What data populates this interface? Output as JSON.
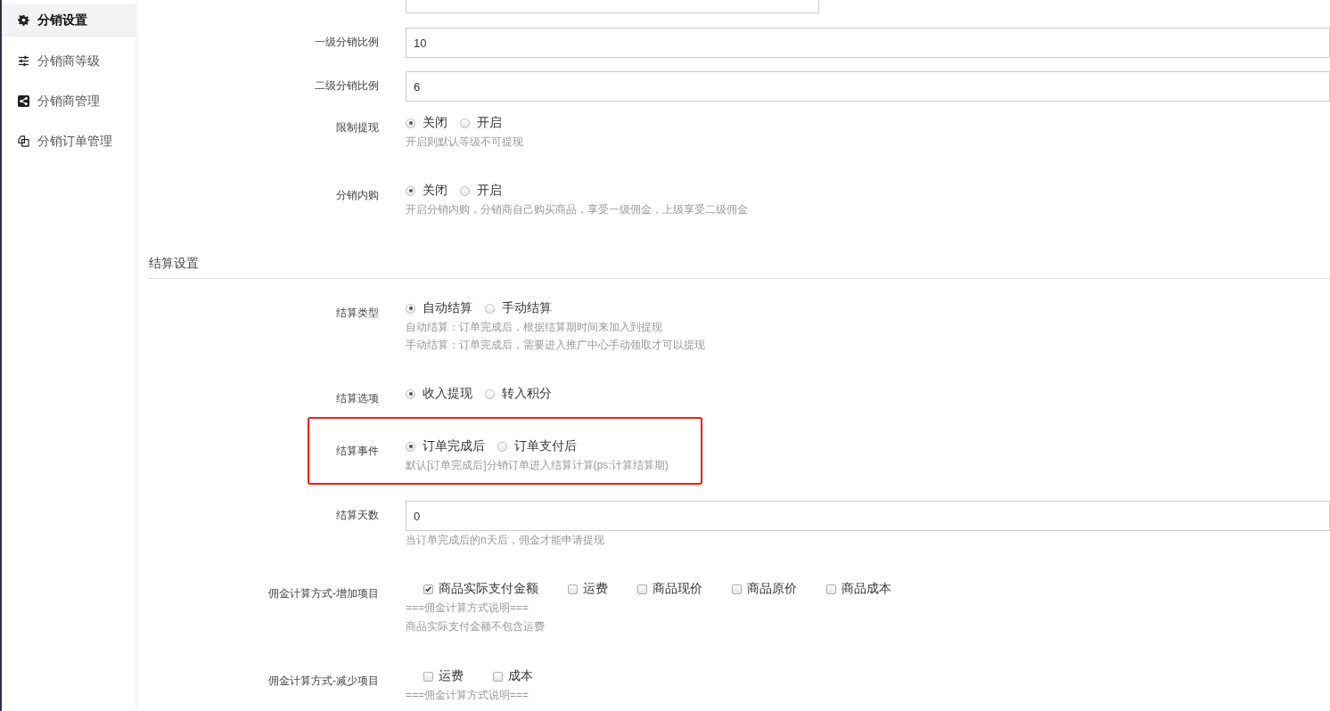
{
  "sidebar": {
    "items": [
      {
        "label": "分销设置",
        "selected": true
      },
      {
        "label": "分销商等级",
        "selected": false
      },
      {
        "label": "分销商管理",
        "selected": false
      },
      {
        "label": "分销订单管理",
        "selected": false
      }
    ]
  },
  "form": {
    "rows": [
      {
        "kind": "select"
      },
      {
        "kind": "input",
        "label": "一级分销比例",
        "value": "10"
      },
      {
        "kind": "input",
        "label": "二级分销比例",
        "value": "6"
      },
      {
        "kind": "radio",
        "label": "限制提现",
        "options": [
          {
            "label": "关闭",
            "selected": true
          },
          {
            "label": "开启",
            "selected": false
          }
        ],
        "help": [
          "开启则默认等级不可提现"
        ]
      },
      {
        "kind": "radio",
        "label": "分销内购",
        "options": [
          {
            "label": "关闭",
            "selected": true
          },
          {
            "label": "开启",
            "selected": false
          }
        ],
        "help": [
          "开启分销内购，分销商自己购买商品，享受一级佣金，上级享受二级佣金"
        ]
      },
      {
        "kind": "section",
        "title": "结算设置"
      },
      {
        "kind": "radio",
        "label": "结算类型",
        "options": [
          {
            "label": "自动结算",
            "selected": true
          },
          {
            "label": "手动结算",
            "selected": false
          }
        ],
        "help": [
          "自动结算：订单完成后，根据结算期时间来加入到提现",
          "手动结算：订单完成后，需要进入推广中心手动领取才可以提现"
        ]
      },
      {
        "kind": "radio",
        "label": "结算选项",
        "options": [
          {
            "label": "收入提现",
            "selected": true
          },
          {
            "label": "转入积分",
            "selected": false
          }
        ]
      },
      {
        "kind": "radio",
        "label": "结算事件",
        "highlighted": true,
        "options": [
          {
            "label": "订单完成后",
            "selected": true
          },
          {
            "label": "订单支付后",
            "selected": false
          }
        ],
        "help": [
          "默认[订单完成后]分销订单进入结算计算(ps:计算结算期)"
        ]
      },
      {
        "kind": "input",
        "label": "结算天数",
        "value": "0",
        "help": [
          "当订单完成后的n天后，佣金才能申请提现"
        ]
      },
      {
        "kind": "checkbox",
        "label": "佣金计算方式-增加项目",
        "options": [
          {
            "label": "商品实际支付金额",
            "checked": true
          },
          {
            "label": "运费",
            "checked": false
          },
          {
            "label": "商品现价",
            "checked": false
          },
          {
            "label": "商品原价",
            "checked": false
          },
          {
            "label": "商品成本",
            "checked": false
          }
        ],
        "help": [
          "===佣金计算方式说明===",
          "商品实际支付金额不包含运费"
        ]
      },
      {
        "kind": "checkbox",
        "label": "佣金计算方式-减少项目",
        "options": [
          {
            "label": "运费",
            "checked": false
          },
          {
            "label": "成本",
            "checked": false
          }
        ],
        "help": [
          "===佣金计算方式说明==="
        ]
      }
    ]
  }
}
